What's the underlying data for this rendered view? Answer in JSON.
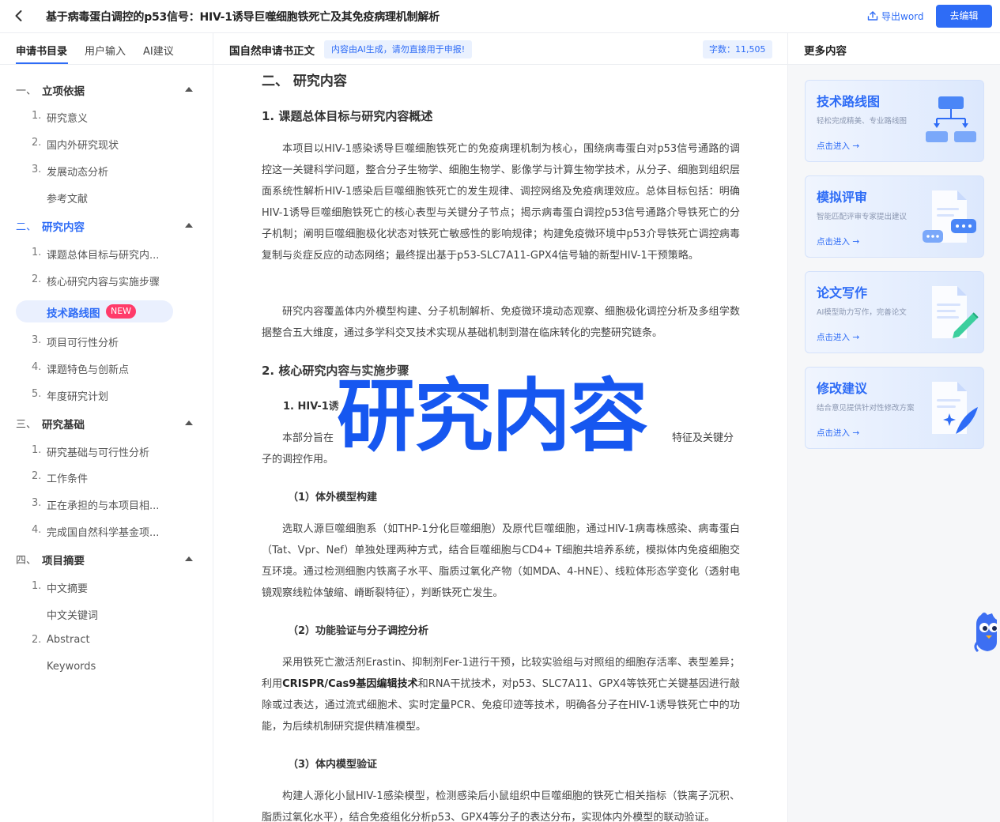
{
  "header": {
    "title": "基于病毒蛋白调控的p53信号：HIV-1诱导巨噬细胞铁死亡及其免疫病理机制解析",
    "export_label": "导出word",
    "edit_label": "去编辑"
  },
  "sidebar": {
    "tabs": [
      "申请书目录",
      "用户输入",
      "AI建议"
    ],
    "sections": [
      {
        "num": "一、",
        "label": "立项依据"
      },
      {
        "num": "二、",
        "label": "研究内容"
      },
      {
        "num": "三、",
        "label": "研究基础"
      },
      {
        "num": "四、",
        "label": "项目摘要"
      }
    ],
    "items": [
      {
        "num": "1.",
        "label": "研究意义"
      },
      {
        "num": "2.",
        "label": "国内外研究现状"
      },
      {
        "num": "3.",
        "label": "发展动态分析"
      },
      {
        "num": "",
        "label": "参考文献"
      },
      {
        "num": "1.",
        "label": "课题总体目标与研究内..."
      },
      {
        "num": "2.",
        "label": "核心研究内容与实施步骤"
      },
      {
        "num": "3.",
        "label": "项目可行性分析"
      },
      {
        "num": "4.",
        "label": "课题特色与创新点"
      },
      {
        "num": "5.",
        "label": "年度研究计划"
      },
      {
        "num": "1.",
        "label": "研究基础与可行性分析"
      },
      {
        "num": "2.",
        "label": "工作条件"
      },
      {
        "num": "3.",
        "label": "正在承担的与本项目相..."
      },
      {
        "num": "4.",
        "label": "完成国自然科学基金项..."
      },
      {
        "num": "1.",
        "label": "中文摘要"
      },
      {
        "num": "",
        "label": "中文关键词"
      },
      {
        "num": "2.",
        "label": "Abstract"
      },
      {
        "num": "",
        "label": "Keywords"
      }
    ],
    "highlight": {
      "label": "技术路线图",
      "badge": "NEW"
    }
  },
  "main": {
    "title": "国自然申请书正文",
    "ai_notice": "内容由AI生成，请勿直接用于申报!",
    "word_count": "字数：11,505",
    "section_heading": "二、 研究内容",
    "h1": "1. 课题总体目标与研究内容概述",
    "p1": "本项目以HIV-1感染诱导巨噬细胞铁死亡的免疫病理机制为核心，围绕病毒蛋白对p53信号通路的调控这一关键科学问题，整合分子生物学、细胞生物学、影像学与计算生物学技术，从分子、细胞到组织层面系统性解析HIV-1感染后巨噬细胞铁死亡的发生规律、调控网络及免疫病理效应。总体目标包括：明确HIV-1诱导巨噬细胞铁死亡的核心表型与关键分子节点；揭示病毒蛋白调控p53信号通路介导铁死亡的分子机制；阐明巨噬细胞极化状态对铁死亡敏感性的影响规律；构建免疫微环境中p53介导铁死亡调控病毒复制与炎症反应的动态网络；最终提出基于p53-SLC7A11-GPX4信号轴的新型HIV-1干预策略。",
    "p2": "研究内容覆盖体内外模型构建、分子机制解析、免疫微环境动态观察、细胞极化调控分析及多组学数据整合五大维度，通过多学科交叉技术实现从基础机制到潜在临床转化的完整研究链条。",
    "h2": "2. 核心研究内容与实施步骤",
    "h2_1": "1. HIV-1诱",
    "p3_start": "本部分旨在",
    "p3_end": "特征及关键分",
    "p3_line2": "子的调控作用。",
    "h3_1": "（1）体外模型构建",
    "p4": "选取人源巨噬细胞系（如THP-1分化巨噬细胞）及原代巨噬细胞，通过HIV-1病毒株感染、病毒蛋白（Tat、Vpr、Nef）单独处理两种方式，结合巨噬细胞与CD4+ T细胞共培养系统，模拟体内免疫细胞交互环境。通过检测细胞内铁离子水平、脂质过氧化产物（如MDA、4-HNE）、线粒体形态学变化（透射电镜观察线粒体皱缩、嵴断裂特征），判断铁死亡发生。",
    "h3_2": "（2）功能验证与分子调控分析",
    "p5_a": "采用铁死亡激活剂Erastin、抑制剂Fer-1进行干预，比较实验组与对照组的细胞存活率、表型差异；利用",
    "p5_b": "CRISPR/Cas9基因编辑技术",
    "p5_c": "和RNA干扰技术，对p53、SLC7A11、GPX4等铁死亡关键基因进行敲除或过表达，通过流式细胞术、实时定量PCR、免疫印迹等技术，明确各分子在HIV-1诱导铁死亡中的功能，为后续机制研究提供精准模型。",
    "h3_3": "（3）体内模型验证",
    "p6": "构建人源化小鼠HIV-1感染模型，检测感染后小鼠组织中巨噬细胞的铁死亡相关指标（铁离子沉积、脂质过氧化水平），结合免疫组化分析p53、GPX4等分子的表达分布，实现体内外模型的联动验证。",
    "overlay": "研究内容"
  },
  "right_panel": {
    "title": "更多内容",
    "cards": [
      {
        "title": "技术路线图",
        "desc": "轻松完成精美、专业路线图",
        "link": "点击进入 →",
        "icon": "flowchart-icon"
      },
      {
        "title": "模拟评审",
        "desc": "智能匹配评审专家提出建议",
        "link": "点击进入 →",
        "icon": "review-chat-icon"
      },
      {
        "title": "论文写作",
        "desc": "AI模型助力写作，完善论文",
        "link": "点击进入 →",
        "icon": "document-pen-icon"
      },
      {
        "title": "修改建议",
        "desc": "结合意见提供针对性修改方案",
        "link": "点击进入 →",
        "icon": "document-sparkle-icon"
      }
    ]
  },
  "colors": {
    "primary": "#2e6cf6",
    "badge": "#ff3b6a",
    "overlay": "#1657f0"
  }
}
